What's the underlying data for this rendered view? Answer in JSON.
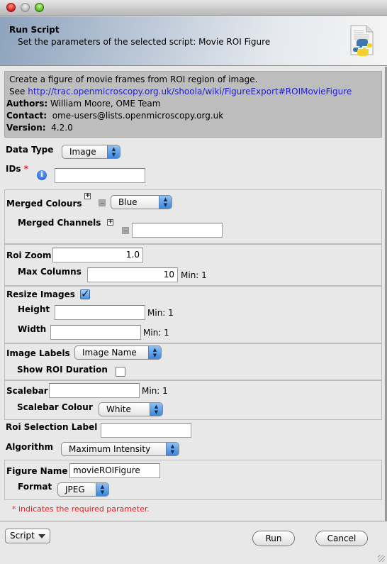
{
  "window": {
    "controls": [
      "close",
      "minimize",
      "zoom"
    ]
  },
  "header": {
    "title": "Run Script",
    "subtitle": "Set the parameters of the selected script: Movie ROI Figure",
    "icon": "python-script-icon"
  },
  "description": {
    "text": "Create a figure of movie frames from ROI region of image.",
    "see_label": "See",
    "link": "http://trac.openmicroscopy.org.uk/shoola/wiki/FigureExport#ROIMovieFigure",
    "authors_label": "Authors:",
    "authors": "William Moore, OME Team",
    "contact_label": "Contact:",
    "contact": "ome-users@lists.openmicroscopy.org.uk",
    "version_label": "Version:",
    "version": "4.2.0"
  },
  "params": {
    "data_type": {
      "label": "Data Type",
      "value": "Image"
    },
    "ids": {
      "label": "IDs",
      "required_mark": "*",
      "value": ""
    },
    "merged_colours": {
      "label": "Merged Colours",
      "value": "Blue"
    },
    "merged_channels": {
      "label": "Merged Channels",
      "value": ""
    },
    "roi_zoom": {
      "label": "Roi Zoom",
      "value": "1.0"
    },
    "max_columns": {
      "label": "Max Columns",
      "value": "10",
      "min": "Min: 1"
    },
    "resize_images": {
      "label": "Resize Images",
      "checked": true
    },
    "height": {
      "label": "Height",
      "value": "",
      "min": "Min: 1"
    },
    "width": {
      "label": "Width",
      "value": "",
      "min": "Min: 1"
    },
    "image_labels": {
      "label": "Image Labels",
      "value": "Image Name"
    },
    "show_roi_duration": {
      "label": "Show ROI Duration",
      "checked": false
    },
    "scalebar": {
      "label": "Scalebar",
      "value": "",
      "min": "Min: 1"
    },
    "scalebar_colour": {
      "label": "Scalebar Colour",
      "value": "White"
    },
    "roi_selection_label": {
      "label": "Roi Selection Label",
      "value": ""
    },
    "algorithm": {
      "label": "Algorithm",
      "value": "Maximum Intensity"
    },
    "figure_name": {
      "label": "Figure Name",
      "value": "movieROIFigure"
    },
    "format": {
      "label": "Format",
      "value": "JPEG"
    }
  },
  "required_note": "* indicates the required parameter.",
  "footer": {
    "script_button": "Script",
    "run_button": "Run",
    "cancel_button": "Cancel"
  },
  "colors": {
    "link": "#1f1fd0",
    "required": "#e02020",
    "description_bg": "#bdbdbd",
    "window_bg": "#e8e8e8"
  }
}
